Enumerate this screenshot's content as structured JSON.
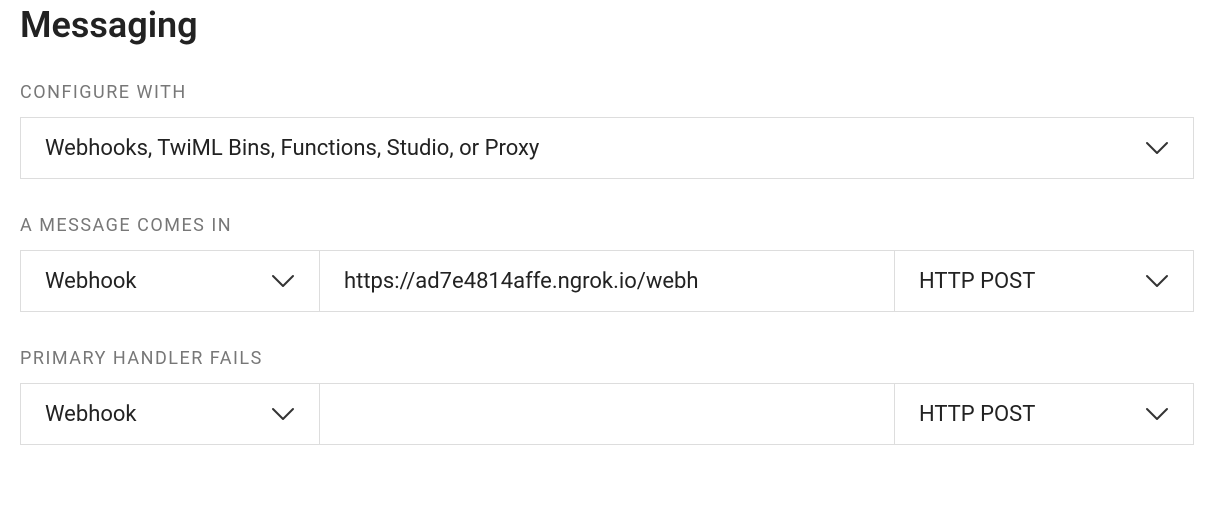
{
  "section": {
    "title": "Messaging"
  },
  "configure_with": {
    "label": "CONFIGURE WITH",
    "value": "Webhooks, TwiML Bins, Functions, Studio, or Proxy"
  },
  "message_comes_in": {
    "label": "A MESSAGE COMES IN",
    "handler_type": "Webhook",
    "url": "https://ad7e4814affe.ngrok.io/webh",
    "method": "HTTP POST"
  },
  "primary_handler_fails": {
    "label": "PRIMARY HANDLER FAILS",
    "handler_type": "Webhook",
    "url": "",
    "method": "HTTP POST"
  },
  "icons": {
    "chevron_name": "chevron-down-icon"
  }
}
